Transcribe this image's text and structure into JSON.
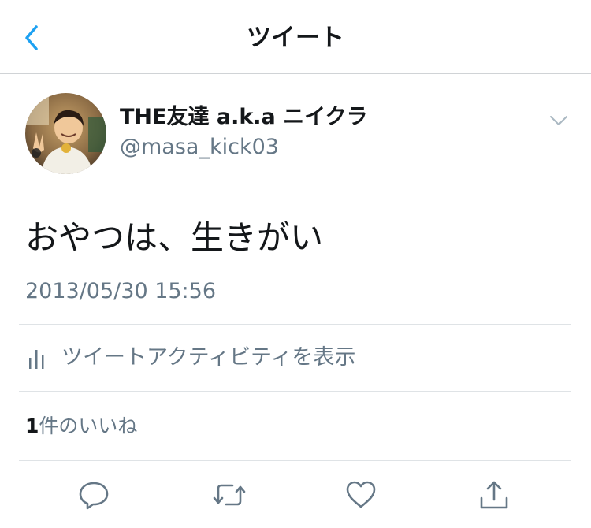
{
  "nav": {
    "title": "ツイート",
    "back_icon": "chevron-left-icon"
  },
  "tweet": {
    "display_name": "THE友達 a.k.a ニイクラ",
    "handle": "@masa_kick03",
    "text": "おやつは、生きがい",
    "timestamp": "2013/05/30 15:56"
  },
  "activity": {
    "icon": "bar-chart-icon",
    "label": "ツイートアクティビティを表示"
  },
  "likes": {
    "count": "1",
    "label": "件のいいね"
  },
  "actions": [
    {
      "name": "reply",
      "icon": "reply-icon"
    },
    {
      "name": "retweet",
      "icon": "retweet-icon"
    },
    {
      "name": "like",
      "icon": "heart-icon"
    },
    {
      "name": "share",
      "icon": "share-icon"
    }
  ],
  "colors": {
    "accent": "#1da1f2",
    "text_primary": "#14171a",
    "text_secondary": "#657786",
    "divider": "#dfe3e6"
  }
}
